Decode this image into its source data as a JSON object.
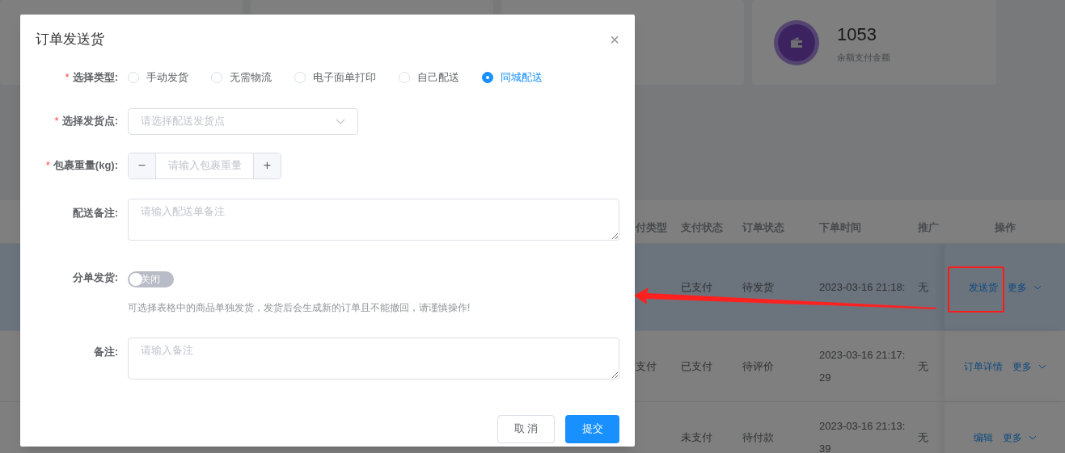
{
  "stats": [
    {
      "value": "1053",
      "label": "余额支付金额"
    }
  ],
  "table": {
    "columns": [
      "付类型",
      "支付状态",
      "订单状态",
      "下单时间",
      "推广",
      "操作"
    ],
    "rows": [
      {
        "selected": true,
        "cells": [
          "",
          "已支付",
          "待发货",
          "2023-03-16 21:18:",
          "无"
        ],
        "actions": [
          {
            "kind": "link",
            "label": "发送货"
          },
          {
            "kind": "more",
            "label": "更多"
          }
        ]
      },
      {
        "selected": false,
        "cells": [
          "支付",
          "已支付",
          "待评价",
          "2023-03-16 21:17:29",
          "无"
        ],
        "actions": [
          {
            "kind": "link",
            "label": "订单详情"
          },
          {
            "kind": "more",
            "label": "更多"
          }
        ]
      },
      {
        "selected": false,
        "cells": [
          "",
          "未支付",
          "待付款",
          "2023-03-16 21:13:39",
          "无"
        ],
        "actions": [
          {
            "kind": "link",
            "label": "编辑"
          },
          {
            "kind": "more",
            "label": "更多"
          }
        ]
      }
    ]
  },
  "dialog": {
    "title": "订单发送货",
    "close": "×",
    "fields": [
      {
        "kind": "radio",
        "label": "选择类型:",
        "required_mark": "*",
        "options": [
          {
            "label": "手动发货",
            "selected": false
          },
          {
            "label": "无需物流",
            "selected": false
          },
          {
            "label": "电子面单打印",
            "selected": false
          },
          {
            "label": "自己配送",
            "selected": false
          },
          {
            "label": "同城配送",
            "selected": true
          }
        ]
      },
      {
        "kind": "select",
        "label": "选择发货点:",
        "required_mark": "*",
        "placeholder": "请选择配送发货点"
      },
      {
        "kind": "number",
        "label": "包裹重量(kg):",
        "required_mark": "*",
        "placeholder": "请输入包裹重量",
        "minus": "−",
        "plus": "+"
      },
      {
        "kind": "textarea",
        "label": "配送备注:",
        "placeholder": "请输入配送单备注"
      },
      {
        "kind": "switch",
        "label": "分单发货:",
        "on": false,
        "switch_text": "关闭",
        "hint": "可选择表格中的商品单独发货，发货后会生成新的订单且不能撤回，请谨慎操作!"
      },
      {
        "kind": "textarea",
        "label": "备注:",
        "placeholder": "请输入备注"
      }
    ],
    "buttons": [
      {
        "kind": "default",
        "label": "取 消"
      },
      {
        "kind": "primary",
        "label": "提交"
      }
    ]
  }
}
